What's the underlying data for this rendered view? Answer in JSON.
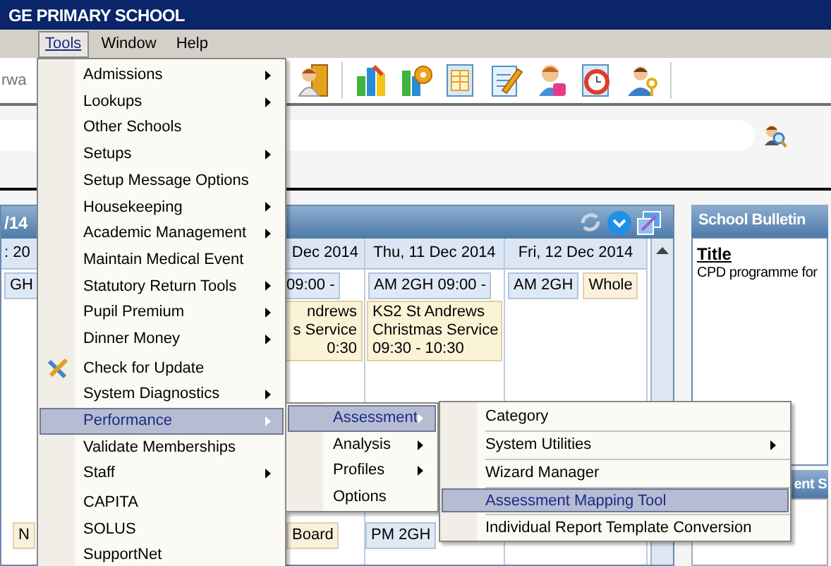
{
  "title_bar": {
    "title": "GE PRIMARY SCHOOL"
  },
  "menu_bar": [
    {
      "label": "Tools",
      "selected": true
    },
    {
      "label": "Window",
      "selected": false
    },
    {
      "label": "Help",
      "selected": false
    }
  ],
  "toolbar": {
    "left_text": "rwa"
  },
  "calendar": {
    "header_text": "/14",
    "columns": [
      {
        "header": ": 20",
        "slots": [
          {
            "text": "GH",
            "kind": "am"
          }
        ],
        "bottom": [
          {
            "text": "N",
            "kind": "allday"
          }
        ]
      },
      {
        "header": "Dec 2014",
        "slots": [
          {
            "text": "09:00 -",
            "kind": "am"
          }
        ],
        "event": {
          "lines": [
            "ndrews",
            "s Service",
            "0:30"
          ]
        },
        "bottom": [
          {
            "text": "Board",
            "kind": "allday"
          }
        ]
      },
      {
        "header": "Thu, 11 Dec 2014",
        "slots": [
          {
            "text": "AM 2GH  09:00 -",
            "kind": "am"
          }
        ],
        "event": {
          "lines": [
            "KS2 St Andrews",
            "Christmas Service",
            "09:30 - 10:30"
          ]
        },
        "bottom": [
          {
            "text": "PM 2GH",
            "kind": "am"
          }
        ]
      },
      {
        "header": "Fri, 12 Dec 2014",
        "slots": [
          {
            "text": "AM 2GH",
            "kind": "am"
          },
          {
            "text": "Whole",
            "kind": "allday"
          }
        ]
      }
    ]
  },
  "bulletin": {
    "header": "School Bulletin",
    "title": "Title",
    "text": "CPD programme for"
  },
  "second_panel": {
    "header": "ent S"
  },
  "tools_menu": [
    {
      "kind": "item",
      "label": "Admissions",
      "submenu": true,
      "selected": false
    },
    {
      "kind": "item",
      "label": "Lookups",
      "submenu": true,
      "selected": false
    },
    {
      "kind": "item",
      "label": "Other Schools",
      "submenu": false,
      "selected": false
    },
    {
      "kind": "item",
      "label": "Setups",
      "submenu": true,
      "selected": false
    },
    {
      "kind": "item",
      "label": "Setup Message Options",
      "submenu": false,
      "selected": false
    },
    {
      "kind": "item",
      "label": "Housekeeping",
      "submenu": true,
      "selected": false
    },
    {
      "kind": "item",
      "label": "Academic Management",
      "submenu": true,
      "selected": false
    },
    {
      "kind": "item",
      "label": "Maintain Medical Event",
      "submenu": false,
      "selected": false
    },
    {
      "kind": "item",
      "label": "Statutory Return Tools",
      "submenu": true,
      "selected": false
    },
    {
      "kind": "item",
      "label": "Pupil Premium",
      "submenu": true,
      "selected": false
    },
    {
      "kind": "item",
      "label": "Dinner Money",
      "submenu": true,
      "selected": false
    },
    {
      "kind": "separator"
    },
    {
      "kind": "item",
      "label": "Check for Update",
      "submenu": false,
      "selected": false,
      "icon": true
    },
    {
      "kind": "item",
      "label": "System Diagnostics",
      "submenu": true,
      "selected": false
    },
    {
      "kind": "item",
      "label": "Performance",
      "submenu": true,
      "selected": true
    },
    {
      "kind": "item",
      "label": "Validate Memberships",
      "submenu": false,
      "selected": false
    },
    {
      "kind": "item",
      "label": "Staff",
      "submenu": true,
      "selected": false
    },
    {
      "kind": "separator"
    },
    {
      "kind": "item",
      "label": "CAPITA",
      "submenu": false,
      "selected": false
    },
    {
      "kind": "item",
      "label": "SOLUS",
      "submenu": false,
      "selected": false
    },
    {
      "kind": "item",
      "label": "SupportNet",
      "submenu": false,
      "selected": false
    }
  ],
  "performance_menu": [
    {
      "kind": "item",
      "label": "Assessment",
      "submenu": true,
      "selected": true
    },
    {
      "kind": "item",
      "label": "Analysis",
      "submenu": true,
      "selected": false
    },
    {
      "kind": "item",
      "label": "Profiles",
      "submenu": true,
      "selected": false
    },
    {
      "kind": "item",
      "label": "Options",
      "submenu": false,
      "selected": false
    }
  ],
  "assessment_menu": [
    {
      "kind": "item",
      "label": "Category",
      "submenu": false,
      "selected": false
    },
    {
      "kind": "separator"
    },
    {
      "kind": "item",
      "label": "System Utilities",
      "submenu": true,
      "selected": false
    },
    {
      "kind": "separator"
    },
    {
      "kind": "item",
      "label": "Wizard Manager",
      "submenu": false,
      "selected": false
    },
    {
      "kind": "separator"
    },
    {
      "kind": "item",
      "label": "Assessment Mapping Tool",
      "submenu": false,
      "selected": true
    },
    {
      "kind": "separator"
    },
    {
      "kind": "item",
      "label": "Individual Report Template Conversion",
      "submenu": false,
      "selected": false
    }
  ]
}
